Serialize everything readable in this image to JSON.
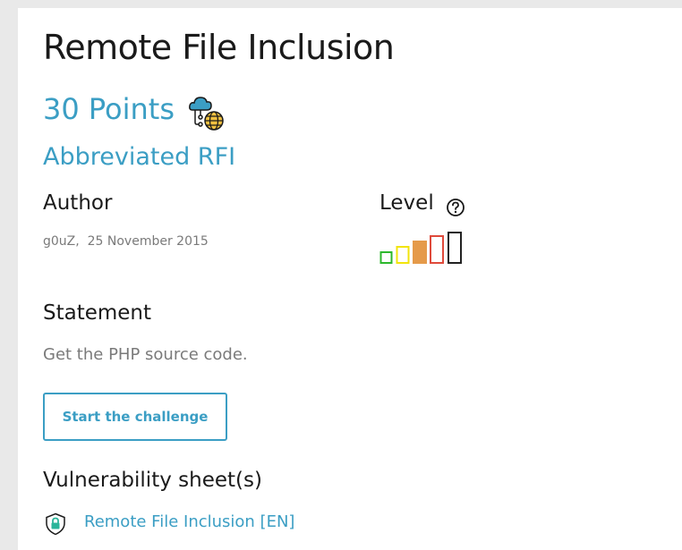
{
  "challenge": {
    "title": "Remote File Inclusion",
    "points_label": "30 Points",
    "category_icon": "cloud-network-icon",
    "subtitle": "Abbreviated RFI"
  },
  "author": {
    "heading": "Author",
    "name": "g0uZ",
    "separator": ",  ",
    "date": "25 November 2015"
  },
  "level": {
    "heading": "Level",
    "help_icon": "question-circle-icon",
    "value": 3,
    "max": 5,
    "colors": [
      "#2db82d",
      "#f2e40c",
      "#e59a4a",
      "#df4a3b",
      "#222222"
    ]
  },
  "statement": {
    "heading": "Statement",
    "text": "Get the PHP source code."
  },
  "actions": {
    "start_label": "Start the challenge"
  },
  "vulnerability": {
    "heading": "Vulnerability sheet(s)",
    "links": [
      {
        "icon": "lock-shield-icon",
        "label": "Remote File Inclusion [EN]"
      }
    ]
  },
  "colors": {
    "accent": "#3b9ec4",
    "page_background": "#e9e9e9"
  }
}
